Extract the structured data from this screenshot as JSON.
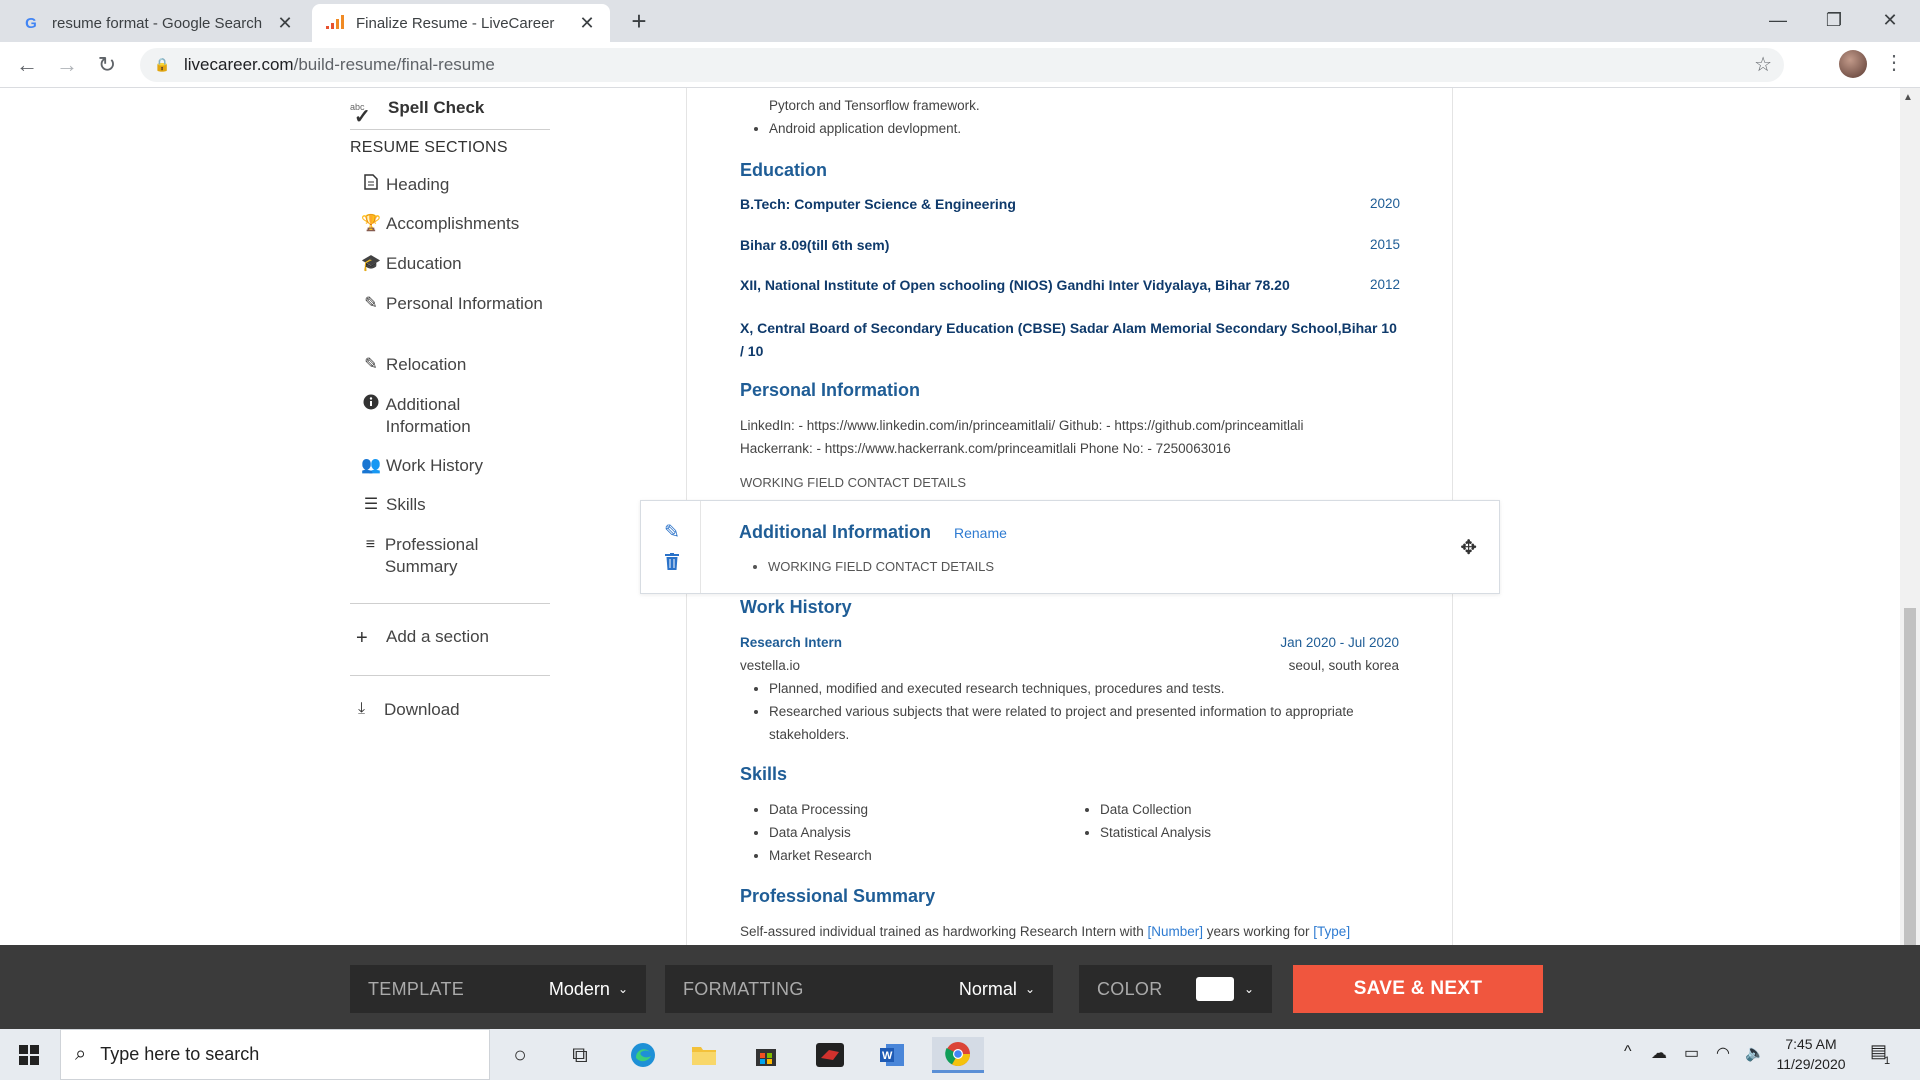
{
  "browser": {
    "tabs": [
      {
        "title": "resume format - Google Search",
        "favicon": "G"
      },
      {
        "title": "Finalize Resume - LiveCareer",
        "favicon": "livecareer-logo-icon"
      }
    ],
    "url_host": "livecareer.com",
    "url_path": "/build-resume/final-resume"
  },
  "sidebar": {
    "spell_check": "Spell Check",
    "spell_abc": "abc",
    "sections_heading": "RESUME SECTIONS",
    "items": [
      {
        "label": "Heading",
        "icon": "document-icon"
      },
      {
        "label": "Accomplishments",
        "icon": "trophy-icon"
      },
      {
        "label": "Education",
        "icon": "graduation-cap-icon"
      },
      {
        "label": "Personal Information",
        "icon": "pencil-icon"
      },
      {
        "label": "Relocation",
        "icon": "pencil-icon"
      },
      {
        "label": "Additional Information",
        "icon": "info-icon"
      },
      {
        "label": "Work History",
        "icon": "users-icon"
      },
      {
        "label": "Skills",
        "icon": "list-icon"
      },
      {
        "label": "Professional Summary",
        "icon": "menu-icon"
      }
    ],
    "add_section": "Add a section",
    "download": "Download"
  },
  "resume": {
    "top_bullets": [
      "Pytorch and Tensorflow framework.",
      "Android application devlopment."
    ],
    "education": {
      "title": "Education",
      "rows": [
        {
          "text": "B.Tech: Computer Science & Engineering",
          "year": "2020"
        },
        {
          "text": "Bihar 8.09(till 6th sem)",
          "year": "2015"
        },
        {
          "text": "XII, National Institute of Open schooling (NIOS) Gandhi Inter Vidyalaya, Bihar 78.20",
          "year": "2012"
        },
        {
          "text": "X, Central Board of Secondary Education (CBSE) Sadar Alam Memorial Secondary School,Bihar 10 / 10",
          "year": ""
        }
      ]
    },
    "personal": {
      "title": "Personal Information",
      "line1": "LinkedIn: - https://www.linkedin.com/in/princeamitlali/ Github: - https://github.com/princeamitlali",
      "line2": "Hackerrank: - https://www.hackerrank.com/princeamitlali Phone No: - 7250063016",
      "line3": "WORKING FIELD CONTACT DETAILS"
    },
    "additional": {
      "title": "Additional Information",
      "rename": "Rename",
      "bullet": "WORKING FIELD CONTACT DETAILS"
    },
    "work": {
      "title": "Work History",
      "job_title": "Research Intern",
      "dates": "Jan 2020 - Jul 2020",
      "company": "vestella.io",
      "location": "seoul, south korea",
      "bullets": [
        "Planned, modified and executed research techniques, procedures and tests.",
        "Researched various subjects that were related to project and presented information to appropriate stakeholders."
      ]
    },
    "skills": {
      "title": "Skills",
      "col1": [
        "Data Processing",
        "Data Analysis",
        "Market Research"
      ],
      "col2": [
        "Data Collection",
        "Statistical Analysis"
      ]
    },
    "summary": {
      "title": "Professional Summary",
      "text_prefix": "Self-assured individual trained as hardworking Research Intern with ",
      "placeholder1": "[Number]",
      "text_middle": " years working for ",
      "placeholder2": "[Type]"
    }
  },
  "bottom_bar": {
    "template_label": "TEMPLATE",
    "template_value": "Modern",
    "formatting_label": "FORMATTING",
    "formatting_value": "Normal",
    "color_label": "COLOR",
    "save_next": "SAVE & NEXT"
  },
  "taskbar": {
    "search_placeholder": "Type here to search",
    "time": "7:45 AM",
    "date": "11/29/2020",
    "notification_count": "1"
  }
}
